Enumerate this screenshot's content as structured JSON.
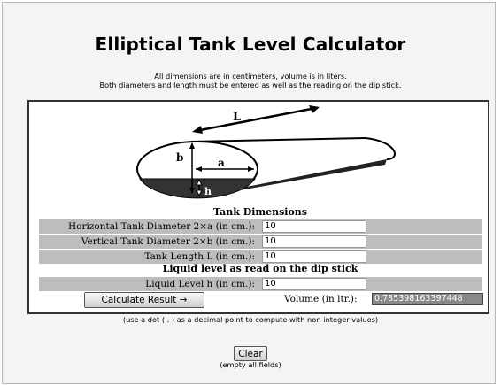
{
  "title": "Elliptical Tank Level Calculator",
  "instructions": {
    "line1": "All dimensions are in centimeters, volume is in liters.",
    "line2": "Both diameters and length must be entered as well as the reading on the dip stick."
  },
  "diagram": {
    "length_label": "L",
    "b_label": "b",
    "a_label": "a",
    "h_label": "h"
  },
  "tank_dimensions": {
    "heading": "Tank Dimensions",
    "horizontal": {
      "label": "Horizontal Tank Diameter 2×a (in cm.):",
      "value": "10"
    },
    "vertical": {
      "label": "Vertical Tank Diameter 2×b (in cm.):",
      "value": "10"
    },
    "length": {
      "label": "Tank Length L (in cm.):",
      "value": "10"
    }
  },
  "liquid": {
    "heading": "Liquid level as read on the dip stick",
    "label": "Liquid Level h (in cm.):",
    "value": "10"
  },
  "calculate_button": "Calculate Result →",
  "volume": {
    "label": "Volume (in ltr.):",
    "value": "0.785398163397448"
  },
  "decimal_note": "(use a dot ( . ) as a decimal point to compute with non-integer values)",
  "clear_button": "Clear",
  "clear_note": "(empty all fields)"
}
